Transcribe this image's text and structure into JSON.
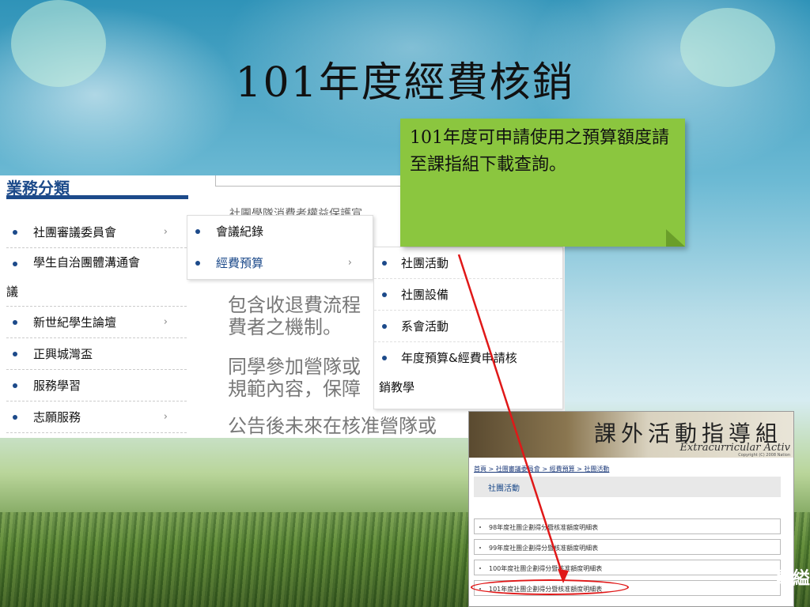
{
  "slide": {
    "title": "101年度經費核銷"
  },
  "left_screenshot": {
    "header": "業務分類",
    "menu": [
      {
        "label": "社團審議委員會",
        "arrow": "›"
      },
      {
        "label": "學生自治團體溝通會",
        "arrow": ""
      },
      {
        "label": "議",
        "arrow": ""
      },
      {
        "label": "新世紀學生論壇",
        "arrow": "›"
      },
      {
        "label": "正興城灣盃",
        "arrow": ""
      },
      {
        "label": "服務學習",
        "arrow": ""
      },
      {
        "label": "志願服務",
        "arrow": "›"
      }
    ],
    "submenu": [
      {
        "label": "會議紀錄",
        "arrow": ""
      },
      {
        "label": "經費預算",
        "arrow": "›"
      }
    ],
    "subsubmenu": [
      {
        "label": "社團活動"
      },
      {
        "label": "社團設備"
      },
      {
        "label": "系會活動"
      },
      {
        "label": "年度預算&經費申請核"
      },
      {
        "label": "銷教學"
      }
    ],
    "background_text": {
      "line_top": "社團學隊消費者權益保護宣",
      "line_a1": "包含收退費流程",
      "line_a2": "費者之機制。",
      "line_b1": "同學參加營隊或",
      "line_b2": "規範內容，保障",
      "line_c": "公告後未來在核准營隊或"
    }
  },
  "note": {
    "text": "101年度可申請使用之預算額度請至課指組下載查詢。"
  },
  "right_screenshot": {
    "banner_title": "課外活動指導組",
    "banner_subtitle": "Extracurricular Activ",
    "banner_copyright": "Copyright (C) 2008 Nation",
    "breadcrumb": "首頁 > 社團審議委員會 > 經費預算 > 社團活動",
    "section_title": "社團活動",
    "rows": [
      "98年度社團企劃得分暨核准額度明細表",
      "99年度社團企劃得分暨核准額度明細表",
      "100年度社團企劃得分暨核准額度明細表",
      "101年度社團企劃得分暨核准額度明細表"
    ],
    "edge_text": "畢縊"
  },
  "colors": {
    "menu_blue": "#1c4a8a",
    "note_green": "#8bc63f",
    "arrow_red": "#e01818"
  }
}
